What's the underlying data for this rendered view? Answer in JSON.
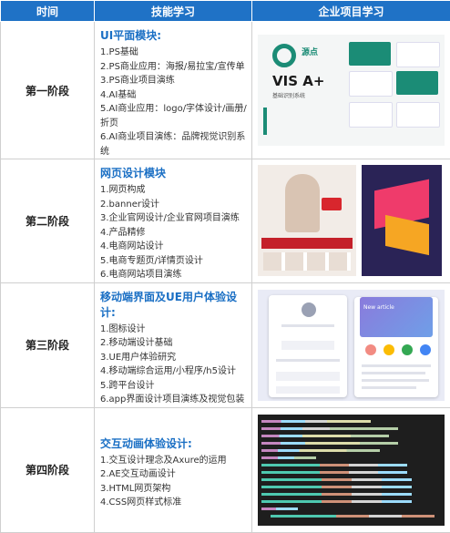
{
  "header": {
    "col_time": "时间",
    "col_skills": "技能学习",
    "col_projects": "企业项目学习"
  },
  "stages": [
    {
      "label": "第一阶段",
      "title": "UI平面模块:",
      "items": [
        "1.PS基础",
        "2.PS商业应用：海报/易拉宝/宣传单",
        "3.PS商业项目演练",
        "4.AI基础",
        "5.AI商业应用：logo/字体设计/画册/折页",
        "6.AI商业项目演练：品牌视觉识别系统"
      ],
      "image": {
        "icon": "brand-identity-mockup",
        "logo_text": "源点",
        "headline": "VIS A+",
        "caption": "基础识别系统"
      }
    },
    {
      "label": "第二阶段",
      "title": "网页设计模块",
      "items": [
        "1.网页构成",
        "2.banner设计",
        "3.企业官网设计/企业官网项目演练",
        "4.产品精修",
        "4.电商网站设计",
        "5.电商专题页/详情页设计",
        "6.电商网站项目演练"
      ],
      "image": {
        "icon": "web-design-mockup"
      }
    },
    {
      "label": "第三阶段",
      "title": "移动端界面及UE用户体验设计:",
      "items": [
        "1.图标设计",
        "2.移动端设计基础",
        "3.UE用户体验研究",
        "4.移动端综合运用/小程序/h5设计",
        "5.跨平台设计",
        "6.app界面设计项目演练及视觉包装"
      ],
      "image": {
        "icon": "mobile-ui-mockup",
        "phone_title": "New article"
      }
    },
    {
      "label": "第四阶段",
      "title": "交互动画体验设计:",
      "items": [
        "1.交互设计理念及Axure的运用",
        "2.AE交互动画设计",
        "3.HTML网页架构",
        "4.CSS网页样式标准"
      ],
      "image": {
        "icon": "code-editor-screenshot"
      }
    }
  ],
  "colors": {
    "header_bg": "#1f72c6",
    "title_blue": "#1a6fc4",
    "border": "#cfcfcf"
  }
}
